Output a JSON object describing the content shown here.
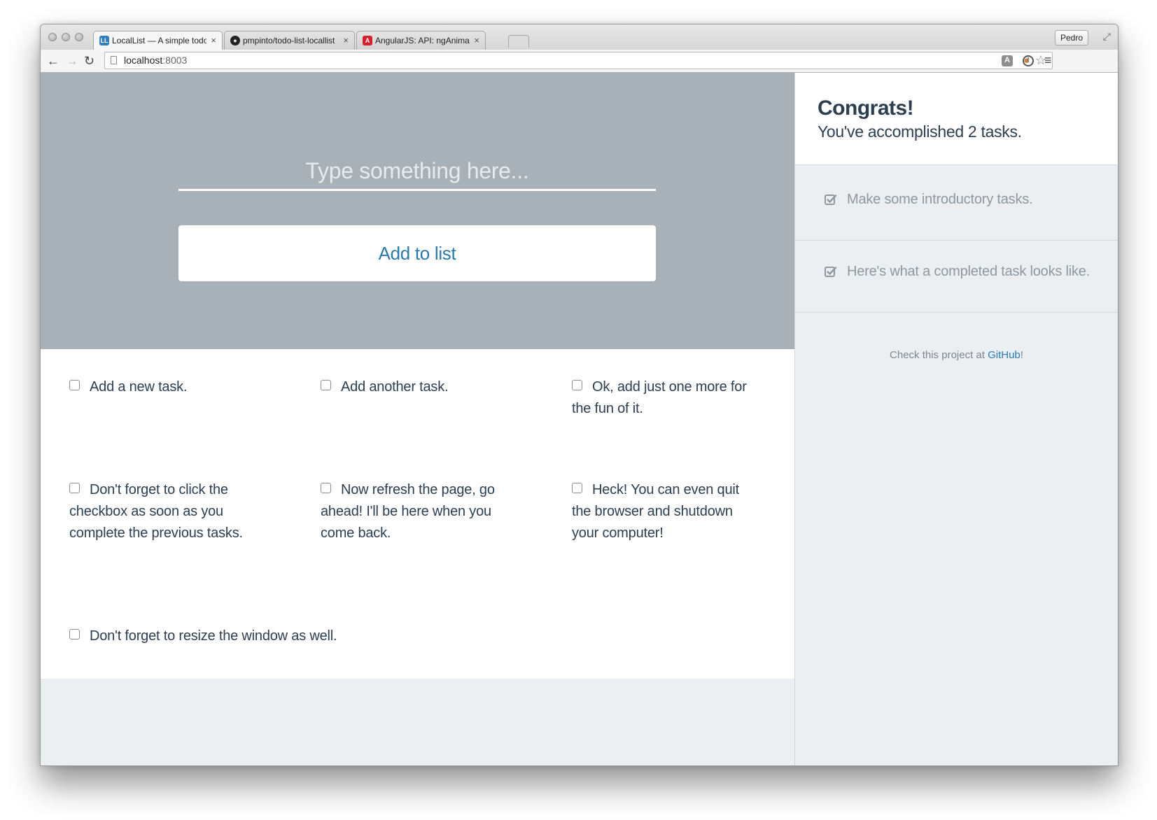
{
  "browser": {
    "tabs": [
      {
        "title": "LocalList — A simple todo",
        "favicon": "LL",
        "active": true
      },
      {
        "title": "pmpinto/todo-list-locallist",
        "favicon": "github-icon",
        "active": false
      },
      {
        "title": "AngularJS: API: ngAnimate",
        "favicon": "angular-icon",
        "active": false
      }
    ],
    "profile": "Pedro",
    "url_host": "localhost",
    "url_port": ":8003"
  },
  "hero": {
    "input_placeholder": "Type something here...",
    "add_button": "Add to list"
  },
  "tasks": [
    {
      "text": "Add a new task.",
      "checked": false
    },
    {
      "text": "Add another task.",
      "checked": false
    },
    {
      "text": "Ok, add just one more for the fun of it.",
      "checked": false
    },
    {
      "text": "Don't forget to click the checkbox as soon as you complete the previous tasks.",
      "checked": false
    },
    {
      "text": "Now refresh the page, go ahead! I'll be here when you come back.",
      "checked": false
    },
    {
      "text": "Heck! You can even quit the browser and shutdown your computer!",
      "checked": false
    },
    {
      "text": "Don't forget to resize the window as well.",
      "checked": false
    }
  ],
  "sidebar": {
    "title": "Congrats!",
    "subtitle": "You've accomplished 2 tasks.",
    "completed": [
      {
        "text": "Make some introductory tasks."
      },
      {
        "text": "Here's what a completed task looks like."
      }
    ],
    "credits_prefix": "Check this project at ",
    "credits_link": "GitHub",
    "credits_suffix": "!"
  },
  "colors": {
    "hero_bg": "#a9b1b8",
    "accent": "#2a7ab0",
    "text_dark": "#2c3e50",
    "muted": "#8f989f",
    "panel_bg": "#eceff1"
  }
}
